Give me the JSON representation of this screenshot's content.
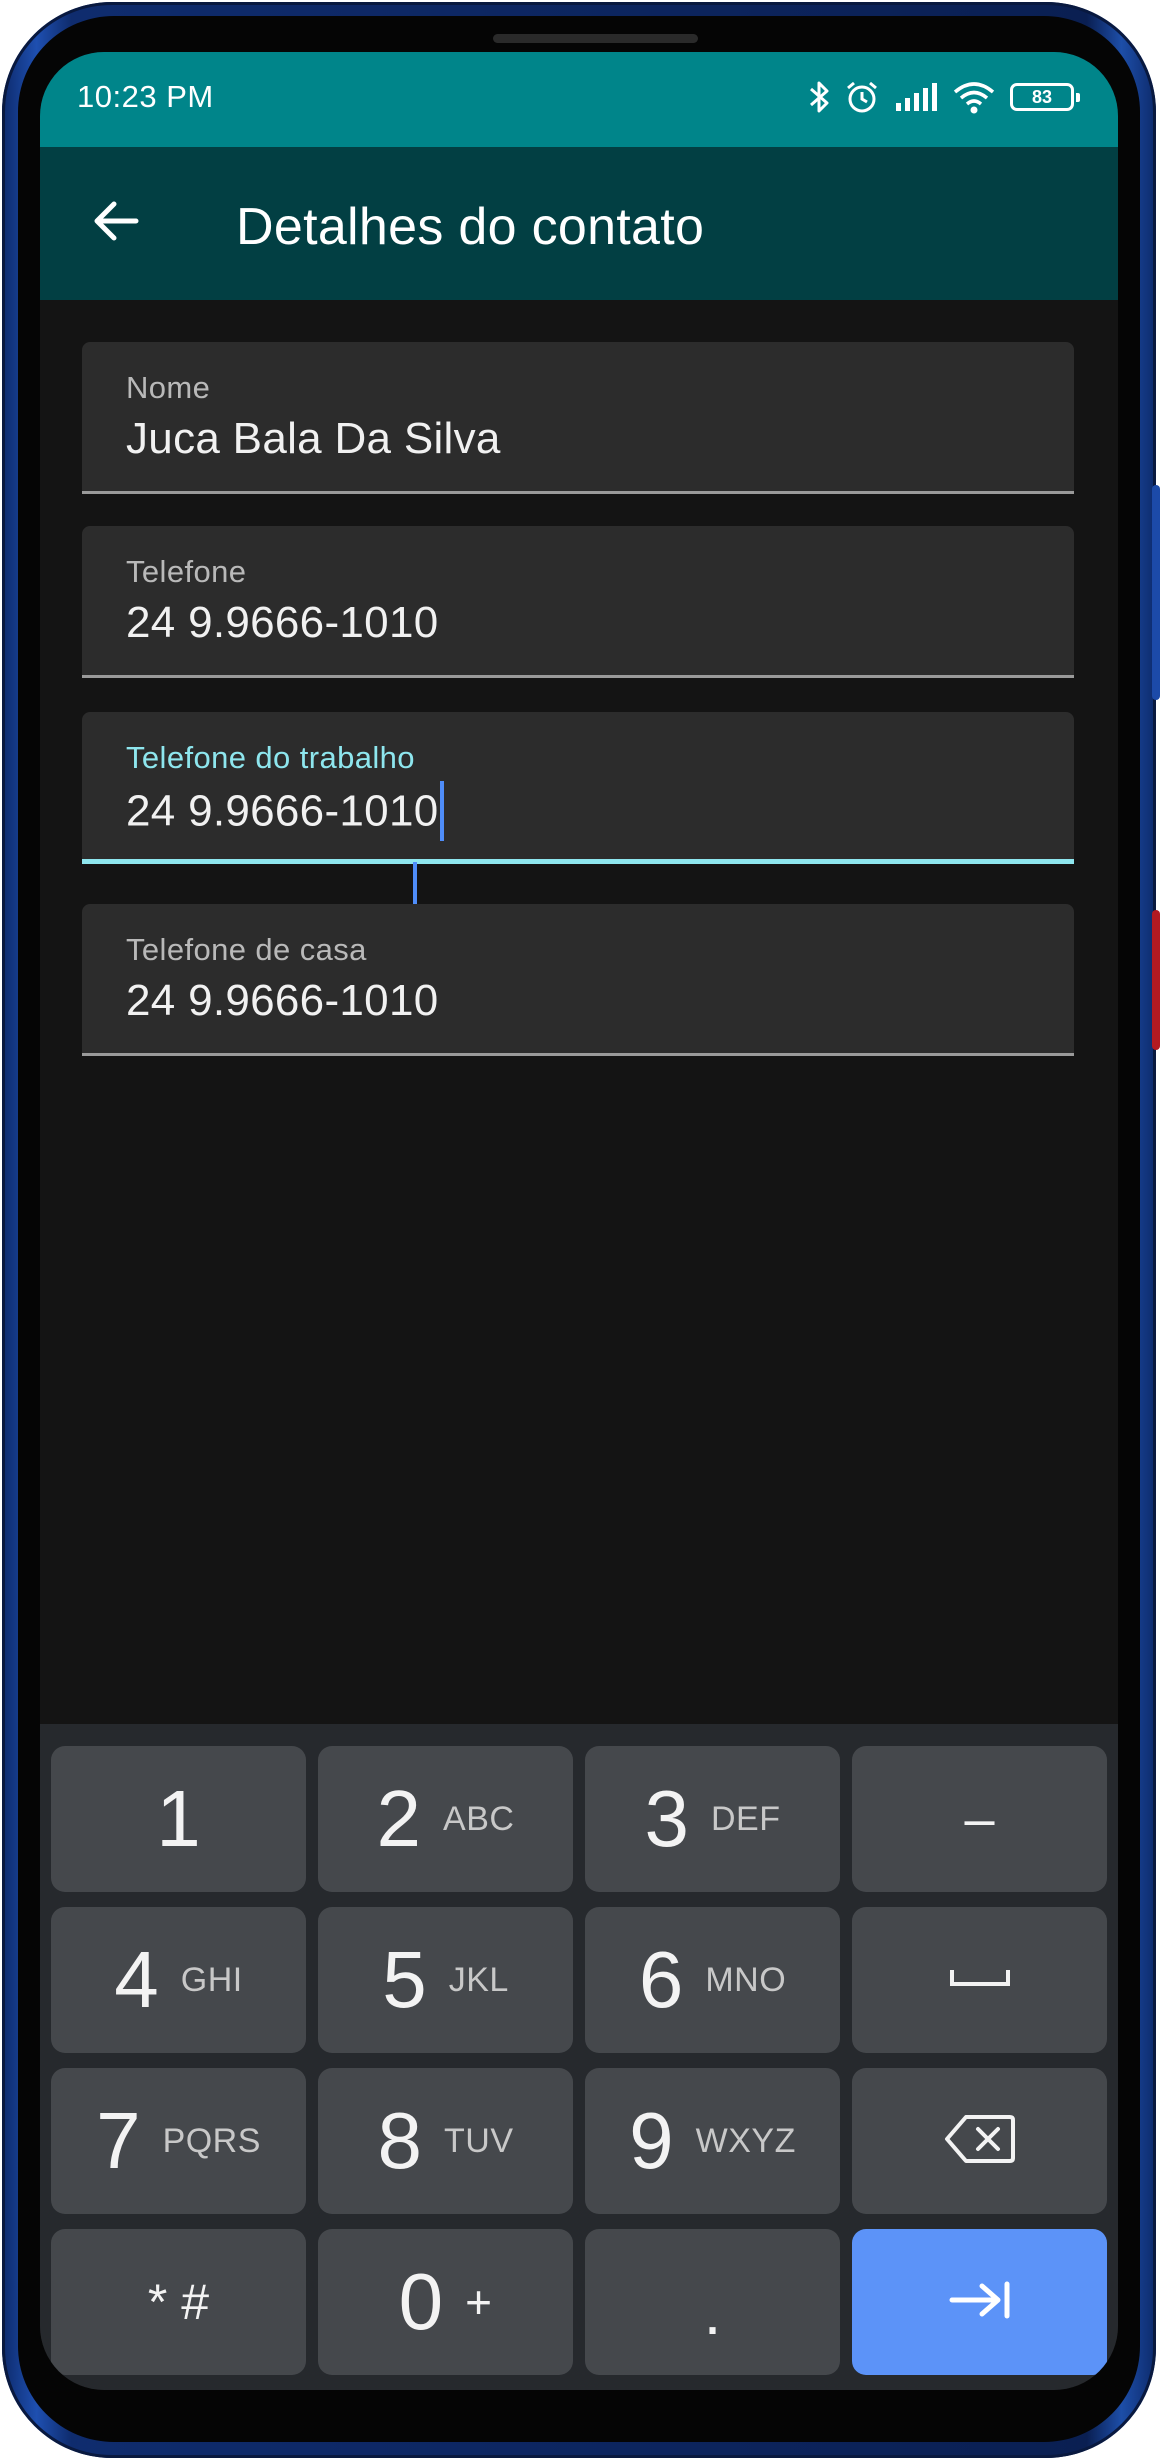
{
  "status_bar": {
    "time": "10:23 PM",
    "battery": "83",
    "icons": [
      "bluetooth-icon",
      "alarm-icon",
      "signal-icon",
      "wifi-icon",
      "battery-icon"
    ]
  },
  "app_bar": {
    "title": "Detalhes do contato",
    "back_icon": "arrow-back-icon"
  },
  "fields": [
    {
      "label": "Nome",
      "value": "Juca Bala Da Silva",
      "focused": false
    },
    {
      "label": "Telefone",
      "value": "24 9.9666-1010",
      "focused": false
    },
    {
      "label": "Telefone do trabalho",
      "value": "24 9.9666-1010",
      "focused": true
    },
    {
      "label": "Telefone de casa",
      "value": "24 9.9666-1010",
      "focused": false
    }
  ],
  "keyboard": {
    "rows": [
      [
        {
          "digit": "1",
          "letters": ""
        },
        {
          "digit": "2",
          "letters": "ABC"
        },
        {
          "digit": "3",
          "letters": "DEF"
        },
        {
          "digit": "–",
          "letters": ""
        }
      ],
      [
        {
          "digit": "4",
          "letters": "GHI"
        },
        {
          "digit": "5",
          "letters": "JKL"
        },
        {
          "digit": "6",
          "letters": "MNO"
        },
        {
          "digit": "␣",
          "letters": ""
        }
      ],
      [
        {
          "digit": "7",
          "letters": "PQRS"
        },
        {
          "digit": "8",
          "letters": "TUV"
        },
        {
          "digit": "9",
          "letters": "WXYZ"
        },
        {
          "digit": "⌫",
          "letters": ""
        }
      ],
      [
        {
          "digit": "* #",
          "letters": ""
        },
        {
          "digit": "0",
          "letters": "+"
        },
        {
          "digit": ".",
          "letters": ""
        },
        {
          "digit": "→|",
          "letters": ""
        }
      ]
    ]
  },
  "colors": {
    "status_bar": "#00858a",
    "app_bar": "#023f43",
    "background": "#141414",
    "focus_accent": "#8ee6ee",
    "enter_key": "#5c93f8"
  }
}
